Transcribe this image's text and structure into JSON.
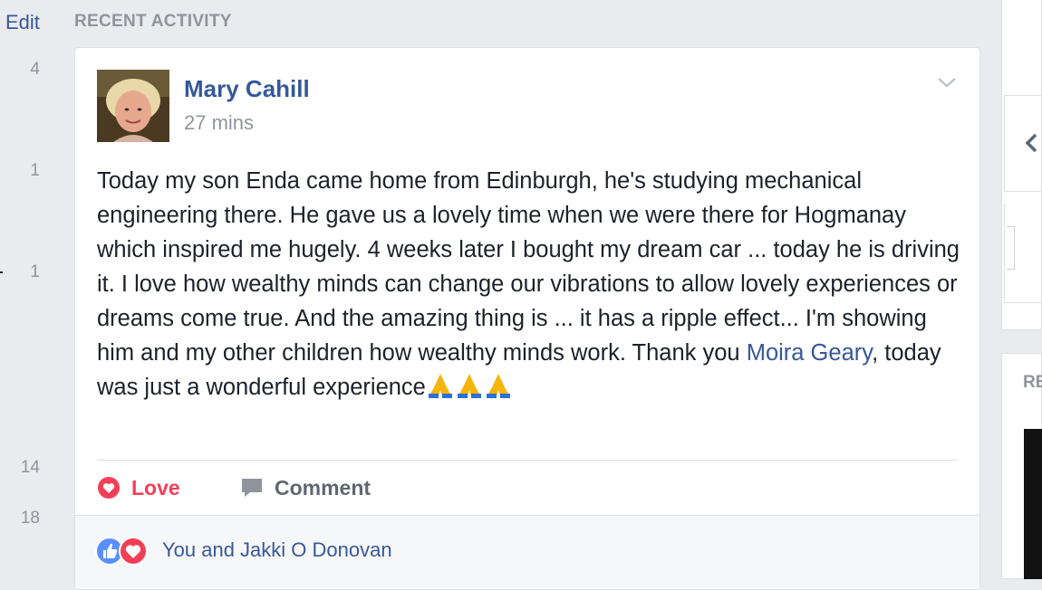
{
  "left_column": {
    "edit_label": "Edit",
    "counts": [
      "4",
      "1",
      "1",
      "14",
      "18"
    ]
  },
  "section_title": "RECENT ACTIVITY",
  "post": {
    "author": "Mary Cahill",
    "time": "27 mins",
    "text_before_mention": "Today my son Enda came home from Edinburgh, he's studying mechanical engineering there. He gave us a lovely time when we were there for Hogmanay which inspired me hugely. 4 weeks later I bought my dream car ... today he is driving it. I love how wealthy minds can change our vibrations to allow lovely experiences or dreams come true. And the amazing thing is ... it has a ripple effect... I'm showing him and my other children how wealthy minds work. Thank you ",
    "mention": "Moira Geary",
    "text_after_mention": ", today was just a wonderful experience",
    "emojis": [
      "folded-hands-icon",
      "folded-hands-icon",
      "folded-hands-icon"
    ],
    "actions": {
      "love_label": "Love",
      "comment_label": "Comment"
    },
    "reactions_text": "You and Jakki O Donovan",
    "reaction_icons": [
      "like-icon",
      "love-icon"
    ]
  },
  "right_rail": {
    "section_label": "RE"
  },
  "colors": {
    "link_blue": "#365899",
    "love_red": "#f33e58",
    "like_blue": "#5890ff",
    "muted_gray": "#90949c",
    "page_bg": "#e9ebee"
  }
}
